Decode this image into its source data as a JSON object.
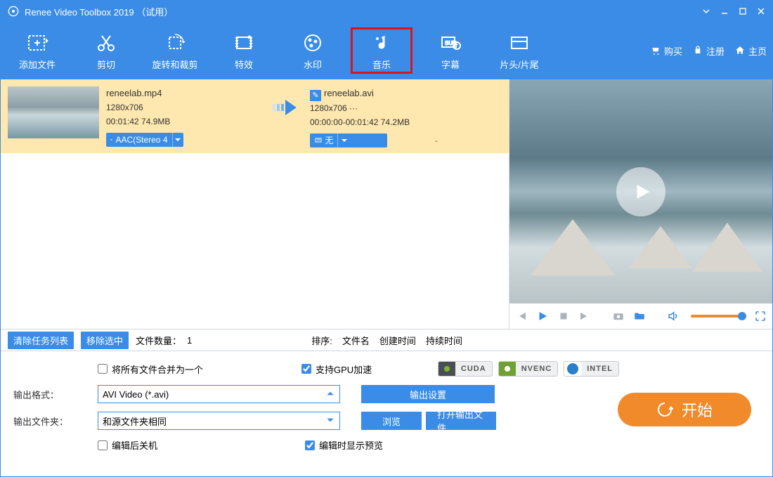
{
  "titlebar": {
    "title": "Renee Video Toolbox 2019 （试用）"
  },
  "toolbar": {
    "items": [
      {
        "label": "添加文件"
      },
      {
        "label": "剪切"
      },
      {
        "label": "旋转和裁剪"
      },
      {
        "label": "特效"
      },
      {
        "label": "水印"
      },
      {
        "label": "音乐"
      },
      {
        "label": "字幕"
      },
      {
        "label": "片头/片尾"
      }
    ],
    "rlinks": {
      "buy": "购买",
      "register": "注册",
      "home": "主页"
    }
  },
  "file": {
    "src": {
      "name": "reneelab.mp4",
      "dims": "1280x706",
      "meta": "00:01:42  74.9MB"
    },
    "dst": {
      "name": "reneelab.avi",
      "dims": "1280x706    ···",
      "meta": "00:00:00-00:01:42  74.2MB"
    },
    "audio_tag": "AAC(Stereo 4",
    "subtitle_tag": "无",
    "dash": "-"
  },
  "listbar": {
    "clear": "清除任务列表",
    "remove": "移除选中",
    "count_label": "文件数量：",
    "count_value": "1",
    "sort_label": "排序:",
    "sort_name": "文件名",
    "sort_created": "创建时间",
    "sort_duration": "持续时间"
  },
  "options": {
    "merge": "将所有文件合并为一个",
    "gpu": "支持GPU加速",
    "badges": {
      "cuda": "CUDA",
      "nvenc": "NVENC",
      "intel": "INTEL"
    },
    "format_label": "输出格式：",
    "format_value": "AVI Video (*.avi)",
    "output_settings": "输出设置",
    "folder_label": "输出文件夹：",
    "folder_value": "和源文件夹相同",
    "browse": "浏览",
    "open_folder": "打开输出文件",
    "shutdown": "编辑后关机",
    "preview_on_edit": "编辑时显示预览",
    "start": "开始"
  }
}
